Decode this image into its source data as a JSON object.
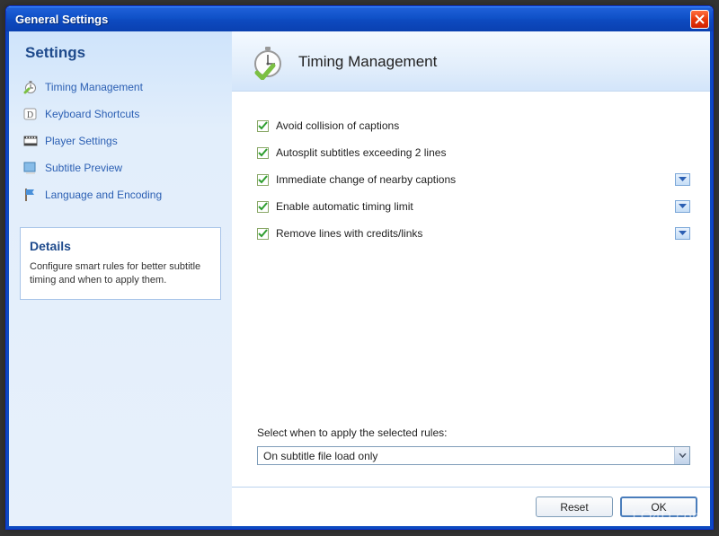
{
  "window": {
    "title": "General Settings"
  },
  "sidebar": {
    "heading": "Settings",
    "items": [
      {
        "label": "Timing Management",
        "icon": "stopwatch-icon"
      },
      {
        "label": "Keyboard Shortcuts",
        "icon": "key-d-icon"
      },
      {
        "label": "Player Settings",
        "icon": "film-icon"
      },
      {
        "label": "Subtitle Preview",
        "icon": "preview-icon"
      },
      {
        "label": "Language and Encoding",
        "icon": "flag-icon"
      }
    ]
  },
  "details": {
    "heading": "Details",
    "text": "Configure smart rules for better subtitle timing and when to apply them."
  },
  "main": {
    "title": "Timing Management",
    "options": [
      {
        "label": "Avoid collision of captions",
        "checked": true,
        "expandable": false
      },
      {
        "label": "Autosplit subtitles exceeding 2 lines",
        "checked": true,
        "expandable": false
      },
      {
        "label": "Immediate change of nearby captions",
        "checked": true,
        "expandable": true
      },
      {
        "label": "Enable automatic timing limit",
        "checked": true,
        "expandable": true
      },
      {
        "label": "Remove lines with credits/links",
        "checked": true,
        "expandable": true
      }
    ],
    "apply_label": "Select when to apply the selected rules:",
    "apply_value": "On subtitle file load only"
  },
  "buttons": {
    "reset": "Reset",
    "ok": "OK"
  },
  "watermark": "LO4D.com"
}
